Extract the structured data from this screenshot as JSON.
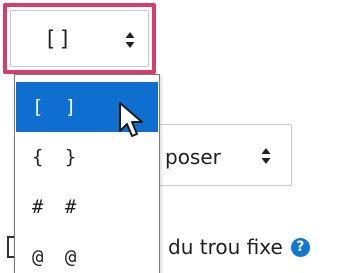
{
  "select_primary": {
    "value": "[]",
    "options": [
      "[ ]",
      "{ }",
      "# #",
      "@ @"
    ],
    "selected_index": 0
  },
  "select_secondary": {
    "value": "poser"
  },
  "field_label": {
    "text": "du trou fixe",
    "help_glyph": "?"
  },
  "icons": {
    "sort": "sort-arrows-icon",
    "help": "question-circle-icon",
    "cursor": "mouse-pointer-icon"
  },
  "colors": {
    "focus_outline": "#d73d6c",
    "selected_option_bg": "#0f6fd0",
    "help_icon_bg": "#1177d1"
  }
}
